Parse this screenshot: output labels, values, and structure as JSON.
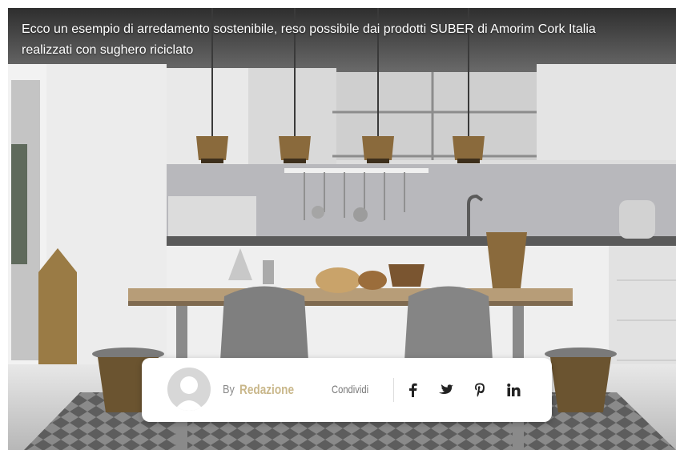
{
  "caption": "Ecco un esempio di arredamento sostenibile, reso possibile dai prodotti SUBER di Amorim Cork Italia realizzati con sughero riciclato",
  "author_bar": {
    "by_label": "By",
    "author_name": "Redazione",
    "share_label": "Condividi",
    "social": [
      "facebook-icon",
      "twitter-icon",
      "pinterest-icon",
      "linkedin-icon"
    ]
  },
  "colors": {
    "author_accent": "#c9b78a",
    "cork": "#8a6a3c",
    "icon_dark": "#222222"
  }
}
